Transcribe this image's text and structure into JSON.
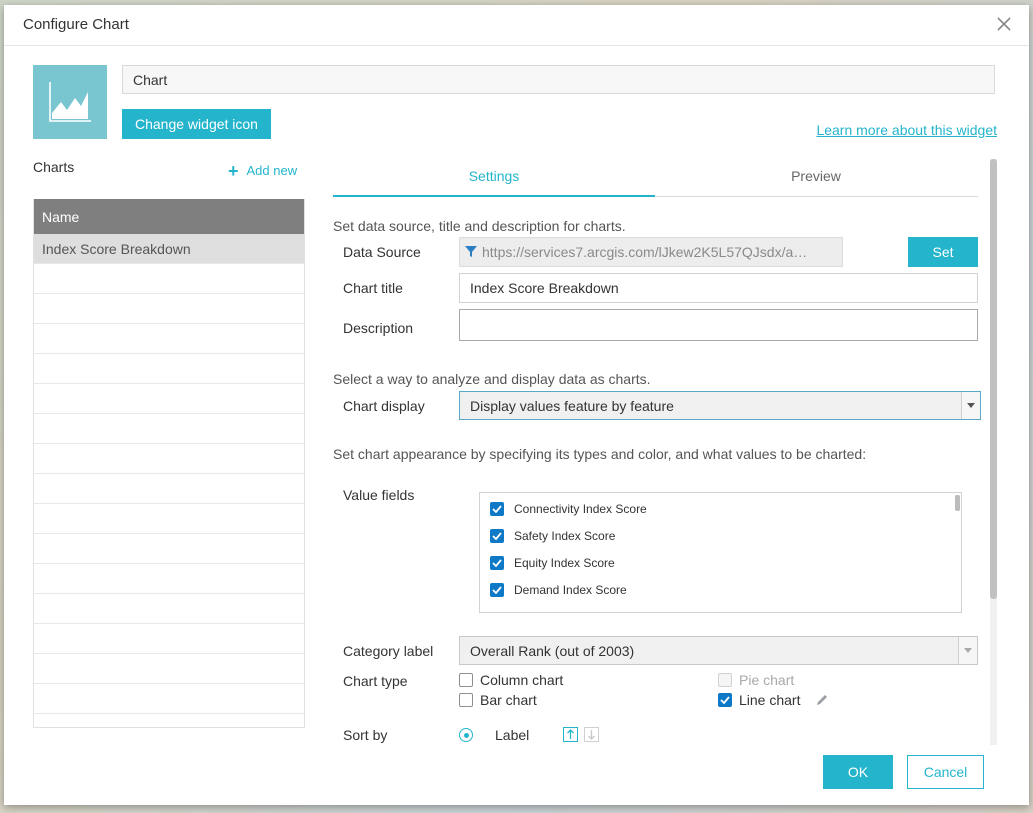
{
  "dialog": {
    "title": "Configure Chart",
    "widget_name": "Chart",
    "change_icon_label": "Change widget icon",
    "learn_more_label": "Learn more about this widget"
  },
  "charts_panel": {
    "label": "Charts",
    "add_new_label": "Add new",
    "column_header": "Name",
    "items": [
      "Index Score Breakdown"
    ]
  },
  "tabs": {
    "settings": "Settings",
    "preview": "Preview"
  },
  "settings": {
    "intro_text": "Set data source, title and description for charts.",
    "data_source_label": "Data Source",
    "data_source_value": "https://services7.arcgis.com/lJkew2K5L57QJsdx/a…",
    "set_label": "Set",
    "chart_title_label": "Chart title",
    "chart_title_value": "Index Score Breakdown",
    "description_label": "Description",
    "description_value": "",
    "analyze_text": "Select a way to analyze and display data as charts.",
    "chart_display_label": "Chart display",
    "chart_display_value": "Display values feature by feature",
    "appearance_text": "Set chart appearance by specifying its types and color, and what values to be charted:",
    "value_fields_label": "Value fields",
    "value_fields": [
      {
        "label": "Connectivity Index Score",
        "checked": true
      },
      {
        "label": "Safety Index Score",
        "checked": true
      },
      {
        "label": "Equity Index Score",
        "checked": true
      },
      {
        "label": "Demand Index Score",
        "checked": true
      }
    ],
    "category_label_label": "Category label",
    "category_label_value": "Overall Rank (out of 2003)",
    "chart_type_label": "Chart type",
    "chart_types": {
      "column": {
        "label": "Column chart",
        "checked": false
      },
      "bar": {
        "label": "Bar chart",
        "checked": false
      },
      "pie": {
        "label": "Pie chart",
        "checked": false,
        "disabled": true
      },
      "line": {
        "label": "Line chart",
        "checked": true
      }
    },
    "sort_by_label": "Sort by",
    "sort_by_value": "Label"
  },
  "footer": {
    "ok_label": "OK",
    "cancel_label": "Cancel"
  },
  "colors": {
    "accent": "#24b5cc",
    "checkbox": "#0d79c7",
    "header_gray": "#7f7f7f"
  }
}
